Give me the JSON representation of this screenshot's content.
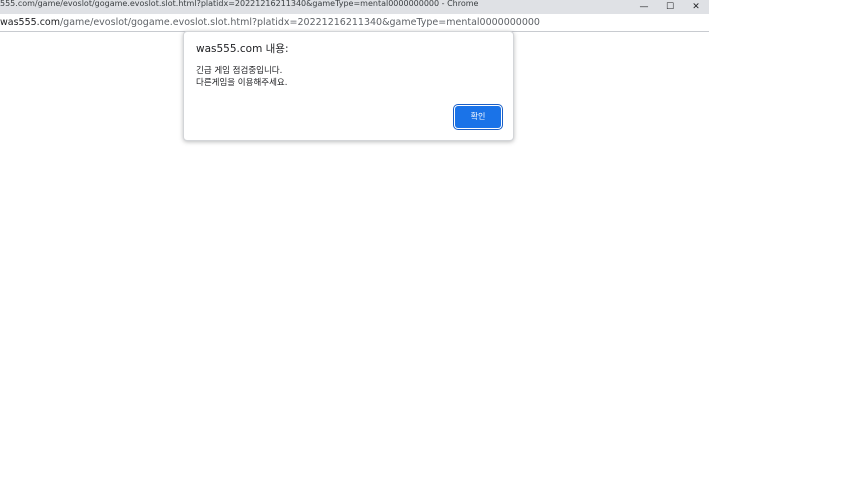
{
  "window": {
    "title": "555.com/game/evoslot/gogame.evoslot.slot.html?platidx=20221216211340&gameType=mental0000000000 - Chrome",
    "controls": {
      "minimize_glyph": "—",
      "maximize_glyph": "☐",
      "close_glyph": "✕"
    }
  },
  "address_bar": {
    "host": "was555.com",
    "path": "/game/evoslot/gogame.evoslot.slot.html?platidx=20221216211340&gameType=mental0000000000"
  },
  "dialog": {
    "title": "was555.com 내용:",
    "message": "긴급 게임 점검중입니다.\n다른게임을 이용해주세요.",
    "ok_label": "확인"
  },
  "colors": {
    "button_blue": "#1a73e8",
    "titlebar_gray": "#dfe1e5"
  }
}
